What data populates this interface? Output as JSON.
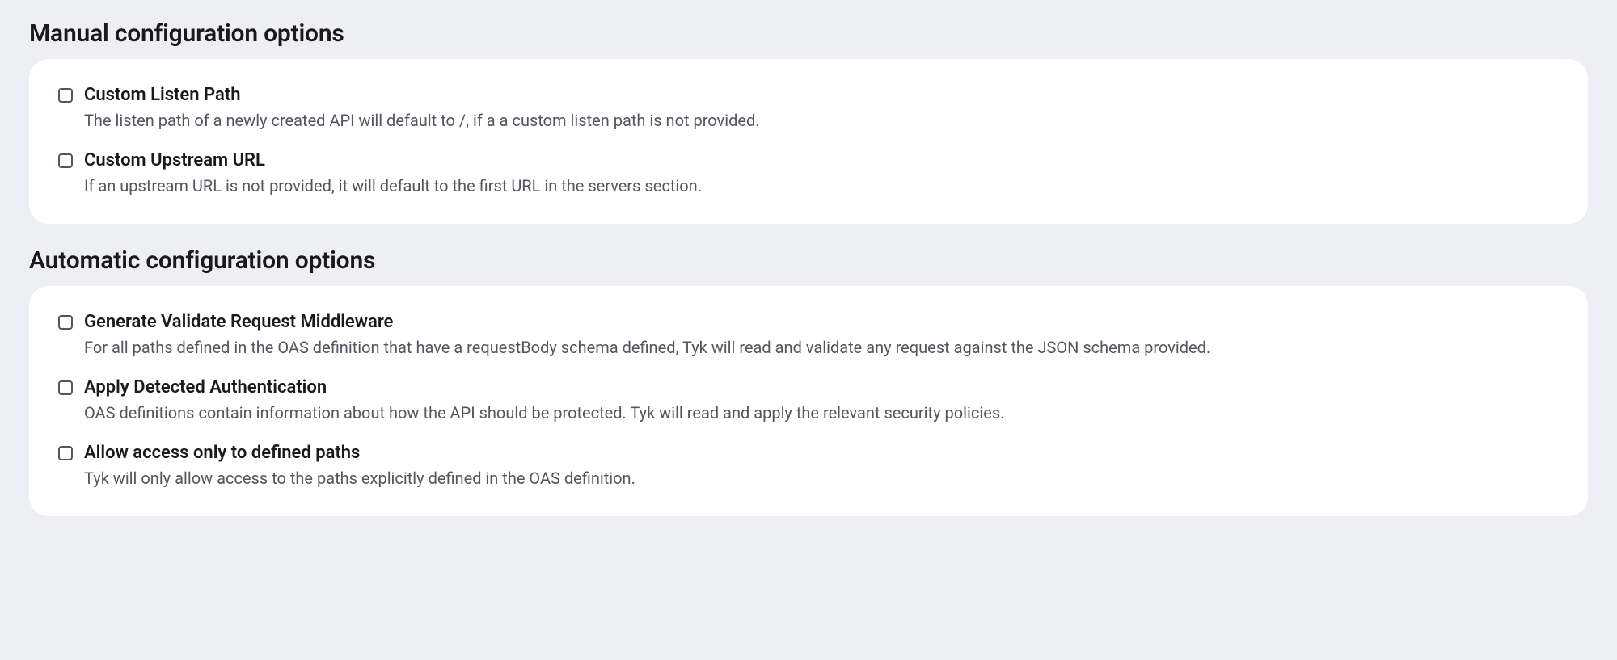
{
  "sections": {
    "manual": {
      "title": "Manual configuration options",
      "options": [
        {
          "label": "Custom Listen Path",
          "desc": "The listen path of a newly created API will default to /, if a a custom listen path is not provided."
        },
        {
          "label": "Custom Upstream URL",
          "desc": "If an upstream URL is not provided, it will default to the first URL in the servers section."
        }
      ]
    },
    "automatic": {
      "title": "Automatic configuration options",
      "options": [
        {
          "label": "Generate Validate Request Middleware",
          "desc": "For all paths defined in the OAS definition that have a requestBody schema defined, Tyk will read and validate any request against the JSON schema provided."
        },
        {
          "label": "Apply Detected Authentication",
          "desc": "OAS definitions contain information about how the API should be protected. Tyk will read and apply the relevant security policies."
        },
        {
          "label": "Allow access only to defined paths",
          "desc": "Tyk will only allow access to the paths explicitly defined in the OAS definition."
        }
      ]
    }
  }
}
